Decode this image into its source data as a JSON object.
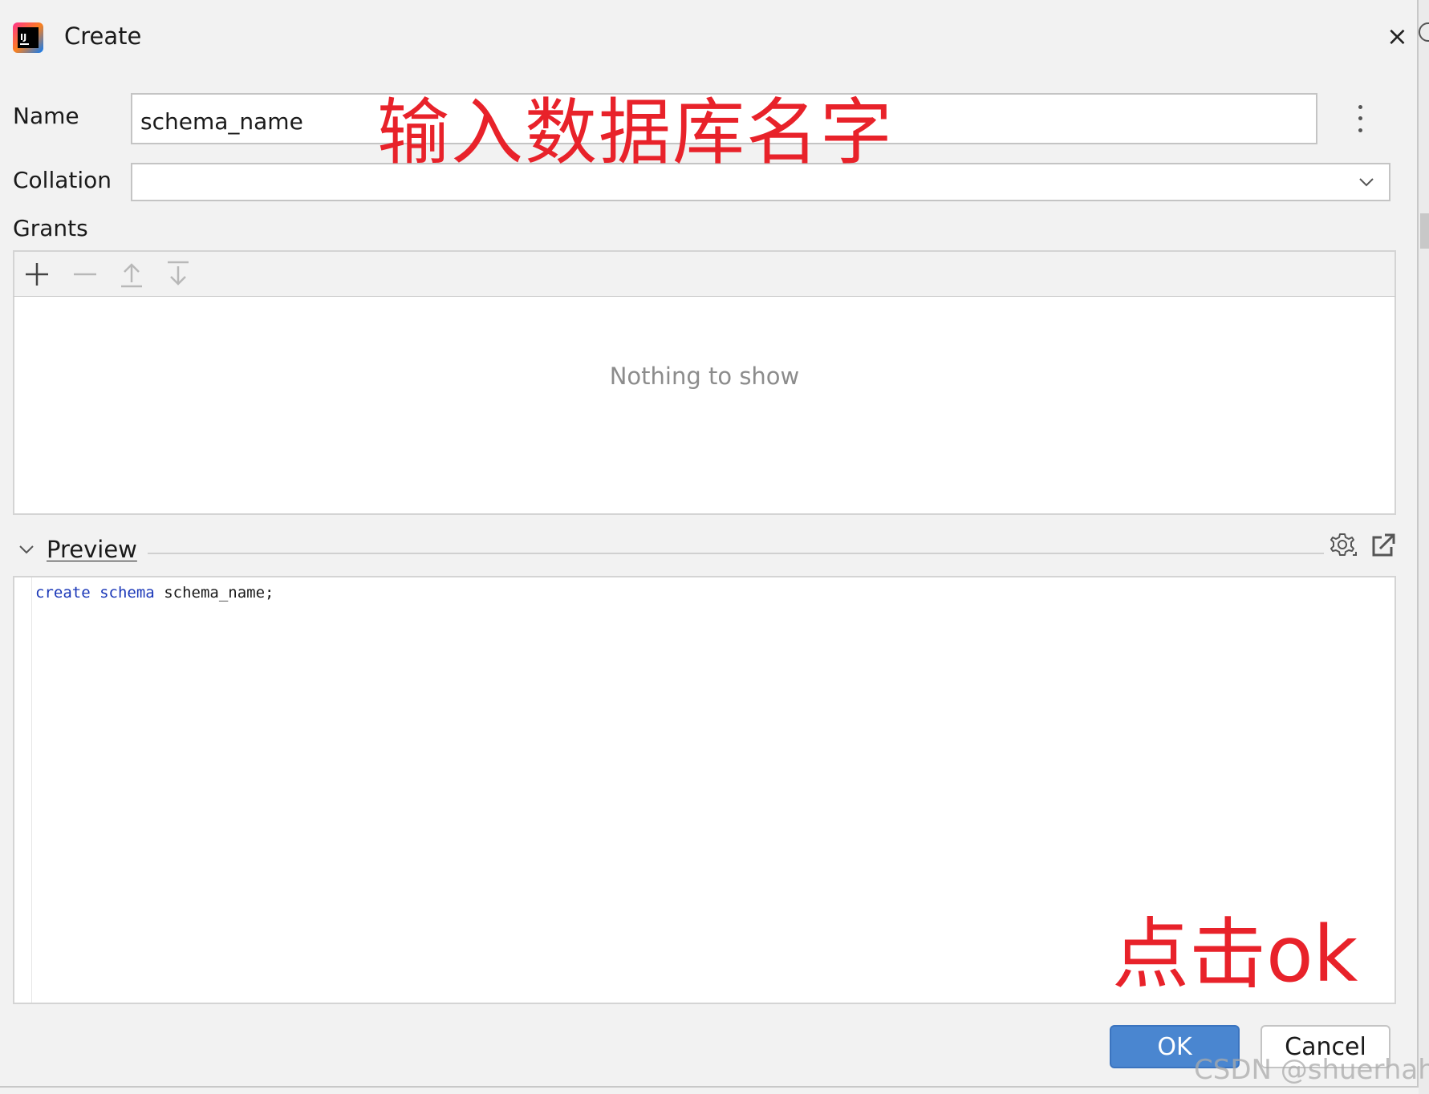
{
  "window": {
    "title": "Create",
    "close_glyph": "×"
  },
  "form": {
    "name_label": "Name",
    "name_value": "schema_name",
    "collation_label": "Collation",
    "collation_value": "",
    "grants_label": "Grants"
  },
  "grants": {
    "toolbar_icons": [
      "add-icon",
      "remove-icon",
      "move-up-icon",
      "move-down-icon"
    ],
    "empty_text": "Nothing to show"
  },
  "preview": {
    "label": "Preview",
    "code": {
      "kw1": "create",
      "kw2": "schema",
      "ident": "schema_name;"
    }
  },
  "annotations": {
    "name_hint": "输入数据库名字",
    "ok_hint": "点击ok"
  },
  "buttons": {
    "ok": "OK",
    "cancel": "Cancel"
  },
  "watermark": "CSDN @shuerhaha",
  "colors": {
    "annotation": "#e8222a",
    "primary_button": "#4a86d0",
    "keyword": "#1b38b8"
  }
}
